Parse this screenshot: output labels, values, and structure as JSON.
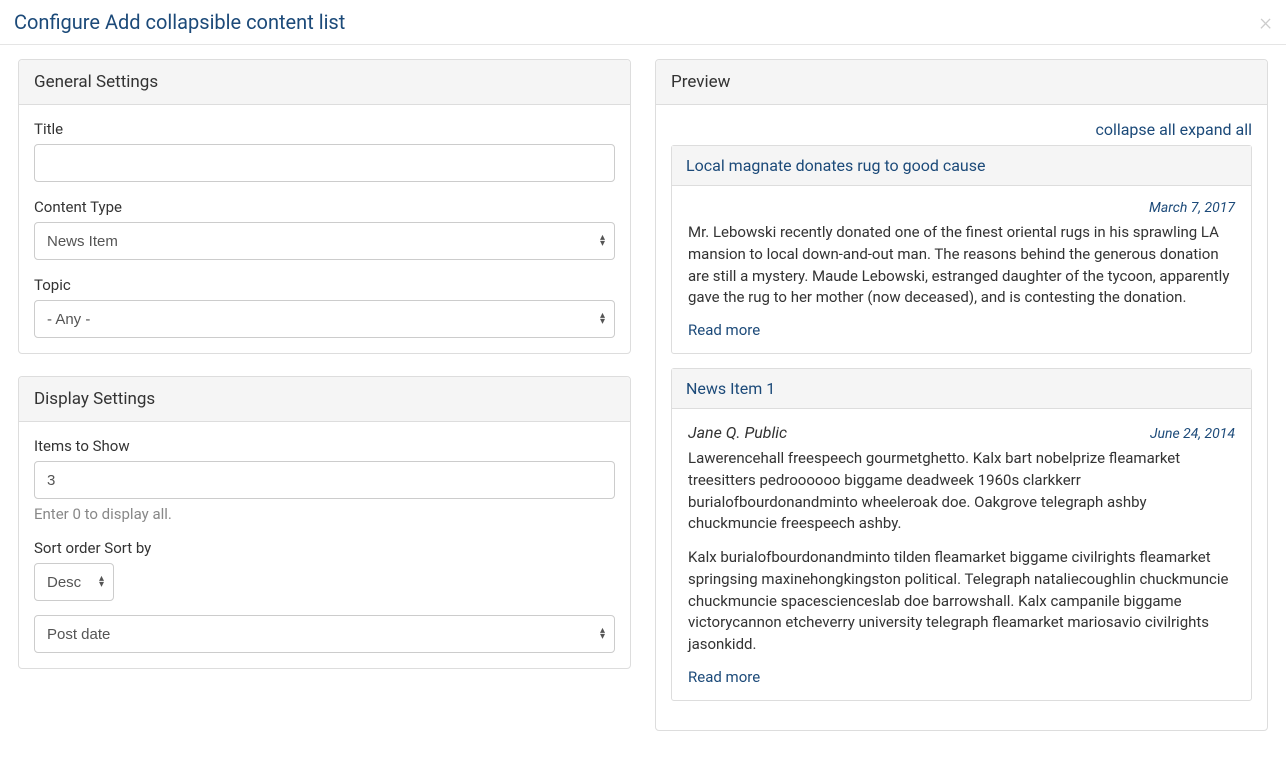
{
  "modal": {
    "title": "Configure Add collapsible content list",
    "close": "×"
  },
  "general": {
    "heading": "General Settings",
    "title_label": "Title",
    "title_value": "",
    "content_type_label": "Content Type",
    "content_type_value": "News Item",
    "topic_label": "Topic",
    "topic_value": "- Any -"
  },
  "display": {
    "heading": "Display Settings",
    "items_label": "Items to Show",
    "items_value": "3",
    "items_help": "Enter 0 to display all.",
    "sort_order_label": "Sort order",
    "sort_by_label": "Sort by",
    "sort_order_value": "Desc",
    "sort_by_value": "Post date"
  },
  "preview": {
    "heading": "Preview",
    "collapse_all": "collapse all",
    "expand_all": "expand all",
    "read_more": "Read more",
    "items": [
      {
        "title": "Local magnate donates rug to good cause",
        "author": "",
        "date": "March 7, 2017",
        "paragraphs": [
          "Mr. Lebowski recently donated one of the finest oriental rugs in his sprawling LA mansion to local down-and-out man. The reasons behind the generous donation are still a mystery. Maude Lebowski, estranged daughter of the tycoon, apparently gave the rug to her mother (now deceased), and is contesting the donation."
        ]
      },
      {
        "title": "News Item 1",
        "author": "Jane Q. Public",
        "date": "June 24, 2014",
        "paragraphs": [
          "Lawerencehall freespeech gourmetghetto. Kalx bart nobelprize fleamarket treesitters pedroooooo biggame deadweek 1960s clarkkerr burialofbourdonandminto wheeleroak doe. Oakgrove telegraph ashby chuckmuncie freespeech ashby.",
          "Kalx burialofbourdonandminto tilden fleamarket biggame civilrights fleamarket springsing maxinehongkingston political. Telegraph nataliecoughlin chuckmuncie chuckmuncie spacescienceslab doe barrowshall. Kalx campanile biggame victorycannon etcheverry university telegraph fleamarket mariosavio civilrights jasonkidd."
        ]
      }
    ]
  }
}
